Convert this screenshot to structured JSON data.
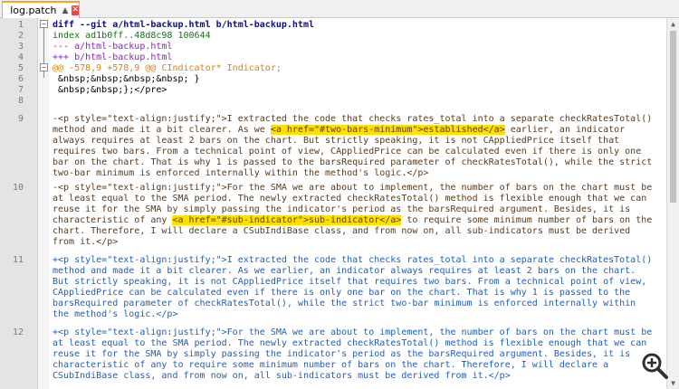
{
  "tab": {
    "title": "log.patch"
  },
  "lines": [
    {
      "num": "1",
      "parts": [
        {
          "t": "diff --git a/html-backup.html b/html-backup.html",
          "c": "c-diff"
        }
      ]
    },
    {
      "num": "2",
      "parts": [
        {
          "t": "index ad1b0ff..48d8c98 100644",
          "c": "c-idx"
        }
      ]
    },
    {
      "num": "3",
      "parts": [
        {
          "t": "--- a/html-backup.html",
          "c": "c-minus"
        }
      ]
    },
    {
      "num": "4",
      "parts": [
        {
          "t": "+++ b/html-backup.html",
          "c": "c-plus"
        }
      ]
    },
    {
      "num": "5",
      "parts": [
        {
          "t": "@@ -578,9 +578,9 @@ CIndicator* Indicator;",
          "c": "c-hunk"
        }
      ]
    },
    {
      "num": "6",
      "parts": [
        {
          "t": " &nbsp;&nbsp;&nbsp;&nbsp; }",
          "c": "c-ctx"
        }
      ]
    },
    {
      "num": "7",
      "parts": [
        {
          "t": " &nbsp;&nbsp;};</pre>",
          "c": "c-ctx"
        }
      ]
    },
    {
      "num": "8",
      "parts": [
        {
          "t": " ",
          "c": "c-ctx"
        }
      ]
    },
    {
      "num": "9",
      "parts": [
        {
          "t": "-<p style=\"text-align:justify;\">I extracted the code that checks rates_total into a separate checkRatesTotal()\nmethod and made it a bit clearer. As we ",
          "c": "c-del"
        },
        {
          "t": "<a href=\"#two-bars-minimum\">established</a>",
          "c": "c-del",
          "hl": true
        },
        {
          "t": " earlier, an indicator\nalways requires at least 2 bars on the chart. But strictly speaking, it is not CAppliedPrice itself that\nrequires two bars. From a technical point of view, CAppliedPrice can be calculated even if there is only one\nbar on the chart. That is why 1 is passed to the barsRequired parameter of checkRatesTotal(), while the strict\ntwo-bar minimum is enforced internally within the method's logic.</p>",
          "c": "c-del"
        }
      ]
    },
    {
      "num": "10",
      "parts": [
        {
          "t": "-<p style=\"text-align:justify;\">For the SMA we are about to implement, the number of bars on the chart must be\nat least equal to the SMA period. The newly extracted checkRatesTotal() method is flexible enough that we can\nreuse it for the SMA by simply passing the indicator's period as the barsRequired argument. Besides, it is\ncharacteristic of any ",
          "c": "c-del"
        },
        {
          "t": "<a href=\"#sub-indicator\">sub-indicator</a>",
          "c": "c-del",
          "hl": true
        },
        {
          "t": " to require some minimum number of bars on the\nchart. Therefore, I will declare a CSubIndiBase class, and from now on, all sub-indicators must be derived\nfrom it.</p>",
          "c": "c-del"
        }
      ]
    },
    {
      "num": "11",
      "parts": [
        {
          "t": "+<p style=\"text-align:justify;\">I extracted the code that checks rates_total into a separate checkRatesTotal()\nmethod and made it a bit clearer. As we earlier, an indicator always requires at least 2 bars on the chart.\nBut strictly speaking, it is not CAppliedPrice itself that requires two bars. From a technical point of view,\nCAppliedPrice can be calculated even if there is only one bar on the chart. That is why 1 is passed to the\nbarsRequired parameter of checkRatesTotal(), while the strict two-bar minimum is enforced internally within\nthe method's logic.</p>",
          "c": "c-add"
        }
      ]
    },
    {
      "num": "12",
      "parts": [
        {
          "t": "+<p style=\"text-align:justify;\">For the SMA we are about to implement, the number of bars on the chart must be\nat least equal to the SMA period. The newly extracted checkRatesTotal() method is flexible enough that we can\nreuse it for the SMA by simply passing the indicator's period as the barsRequired argument. Besides, it is\ncharacteristic of any to require some minimum number of bars on the chart. Therefore, I will declare a\nCSubIndiBase class, and from now on, all sub-indicators must be derived from it.</p>",
          "c": "c-add"
        }
      ]
    },
    {
      "num": "13",
      "parts": [
        {
          "t": " ",
          "c": "c-ctx"
        }
      ]
    }
  ]
}
